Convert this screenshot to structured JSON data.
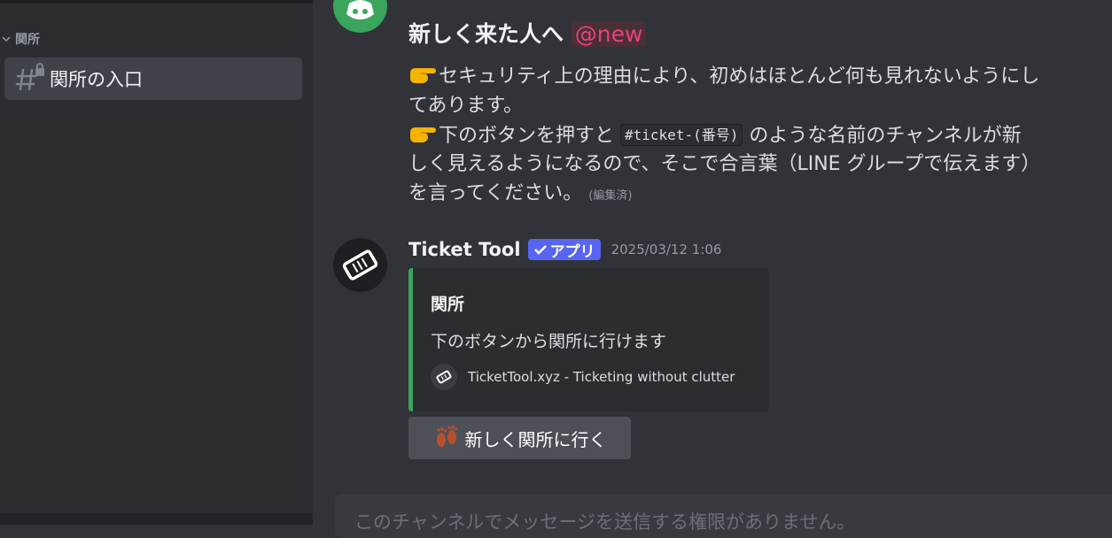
{
  "sidebar": {
    "category": "関所",
    "channel": "関所の入口"
  },
  "message1": {
    "title": "新しく来た人へ",
    "mention": "@new",
    "line1": "セキュリティ上の理由により、初めはほとんど何も見れないようにし",
    "line2": "てあります。",
    "line3_pre": "下のボタンを押すと",
    "line3_code": "#ticket-(番号)",
    "line3_post": "のような名前のチャンネルが新",
    "line4": "しく見えるようになるので、そこで合言葉（LINE グループで伝えます）",
    "line5": "を言ってください。",
    "edited": "(編集済)"
  },
  "message2": {
    "author": "Ticket Tool",
    "badge": "アプリ",
    "timestamp": "2025/03/12 1:06",
    "embed": {
      "title": "関所",
      "description": "下のボタンから関所に行けます",
      "footer": "TicketTool.xyz - Ticketing without clutter",
      "accent_color": "#3ba55d"
    },
    "button_label": "新しく関所に行く"
  },
  "input": {
    "placeholder": "このチャンネルでメッセージを送信する権限がありません。"
  },
  "icons": [
    "chevron-down-icon",
    "locked-hash-icon",
    "discord-logo-icon",
    "pointing-hand-icon",
    "ticket-icon",
    "check-icon",
    "footprints-icon"
  ]
}
